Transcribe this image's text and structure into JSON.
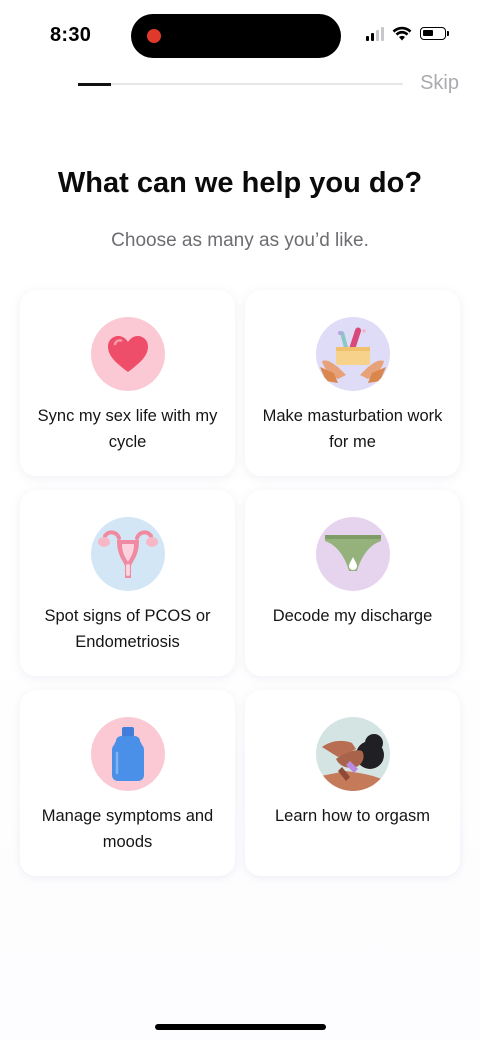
{
  "status_bar": {
    "time": "8:30",
    "battery_level": 0.5
  },
  "header": {
    "progress": 0.1,
    "skip_label": "Skip"
  },
  "title": "What can we help you do?",
  "subtitle": "Choose as many as you’d like.",
  "options": [
    {
      "label": "Sync my sex life with my cycle",
      "icon": "heart-icon",
      "circle_color": "#fbc9d4"
    },
    {
      "label": "Make masturbation work for me",
      "icon": "hands-gift-icon",
      "circle_color": "#dedcf6"
    },
    {
      "label": "Spot signs of PCOS or Endometriosis",
      "icon": "uterus-icon",
      "circle_color": "#d3e6f6"
    },
    {
      "label": "Decode my discharge",
      "icon": "underwear-icon",
      "circle_color": "#e6d4ee"
    },
    {
      "label": "Manage symptoms and moods",
      "icon": "hot-water-bottle-icon",
      "circle_color": "#fbc9d4"
    },
    {
      "label": "Learn how to orgasm",
      "icon": "person-illustration-icon",
      "circle_color": "#d4e4e2"
    }
  ],
  "colors": {
    "accent_heart": "#ef4e6a",
    "text": "#111111",
    "muted": "#6d6d72",
    "skip": "#aaaaaf"
  }
}
